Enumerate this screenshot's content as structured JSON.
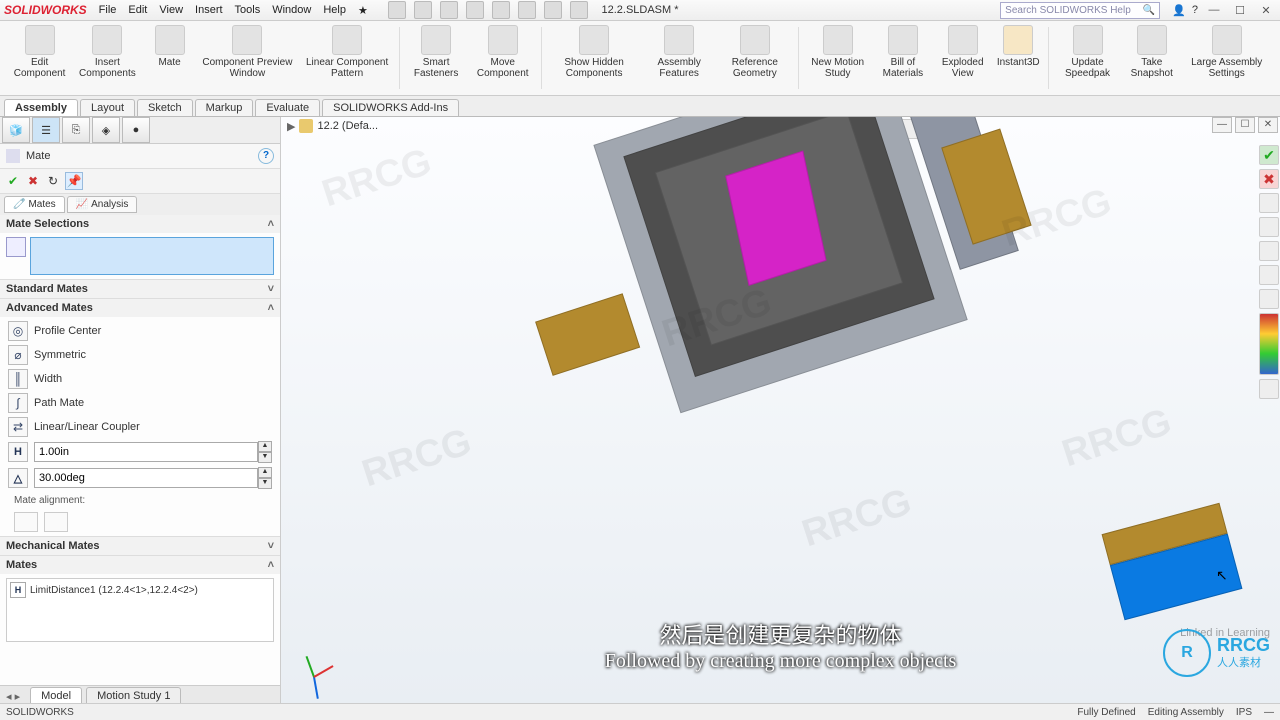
{
  "app": {
    "logo": "SOLIDWORKS",
    "doc_title": "12.2.SLDASM *",
    "search_placeholder": "Search SOLIDWORKS Help"
  },
  "menu": [
    "File",
    "Edit",
    "View",
    "Insert",
    "Tools",
    "Window",
    "Help"
  ],
  "ribbon": [
    {
      "label": "Edit Component"
    },
    {
      "label": "Insert Components"
    },
    {
      "label": "Mate"
    },
    {
      "label": "Component Preview Window"
    },
    {
      "label": "Linear Component Pattern"
    },
    {
      "label": "Smart Fasteners"
    },
    {
      "label": "Move Component"
    },
    {
      "label": "Show Hidden Components"
    },
    {
      "label": "Assembly Features"
    },
    {
      "label": "Reference Geometry"
    },
    {
      "label": "New Motion Study"
    },
    {
      "label": "Bill of Materials"
    },
    {
      "label": "Exploded View"
    },
    {
      "label": "Instant3D"
    },
    {
      "label": "Update Speedpak"
    },
    {
      "label": "Take Snapshot"
    },
    {
      "label": "Large Assembly Settings"
    }
  ],
  "tabs": [
    "Assembly",
    "Layout",
    "Sketch",
    "Markup",
    "Evaluate",
    "SOLIDWORKS Add-Ins"
  ],
  "active_tab": "Assembly",
  "breadcrumb": "12.2 (Defa...",
  "property_panel": {
    "title": "Mate",
    "subtabs": [
      "Mates",
      "Analysis"
    ],
    "active_subtab": "Mates",
    "sections": {
      "selections": "Mate Selections",
      "standard": "Standard Mates",
      "advanced": "Advanced Mates",
      "mechanical": "Mechanical Mates",
      "mates": "Mates"
    },
    "advanced_items": [
      {
        "icon": "◎",
        "label": "Profile Center"
      },
      {
        "icon": "⌀",
        "label": "Symmetric"
      },
      {
        "icon": "║",
        "label": "Width"
      },
      {
        "icon": "∫",
        "label": "Path Mate"
      },
      {
        "icon": "⇄",
        "label": "Linear/Linear Coupler"
      }
    ],
    "distance_icon": "H",
    "distance_value": "1.00in",
    "angle_icon": "△",
    "angle_value": "30.00deg",
    "alignment_label": "Mate alignment:",
    "mates_list": [
      {
        "icon": "H",
        "label": "LimitDistance1 (12.2.4<1>,12.2.4<2>)"
      }
    ]
  },
  "bottom_tabs": [
    "Model",
    "Motion Study 1"
  ],
  "status": {
    "left": "SOLIDWORKS",
    "right": [
      "Fully Defined",
      "Editing Assembly",
      "IPS",
      "—"
    ]
  },
  "caption": {
    "cn": "然后是创建更复杂的物体",
    "en": "Followed by creating more complex objects"
  },
  "overlay": {
    "watermark": "RRCG",
    "rrcg_sub": "人人素材",
    "linkedin": "Linked in Learning"
  }
}
